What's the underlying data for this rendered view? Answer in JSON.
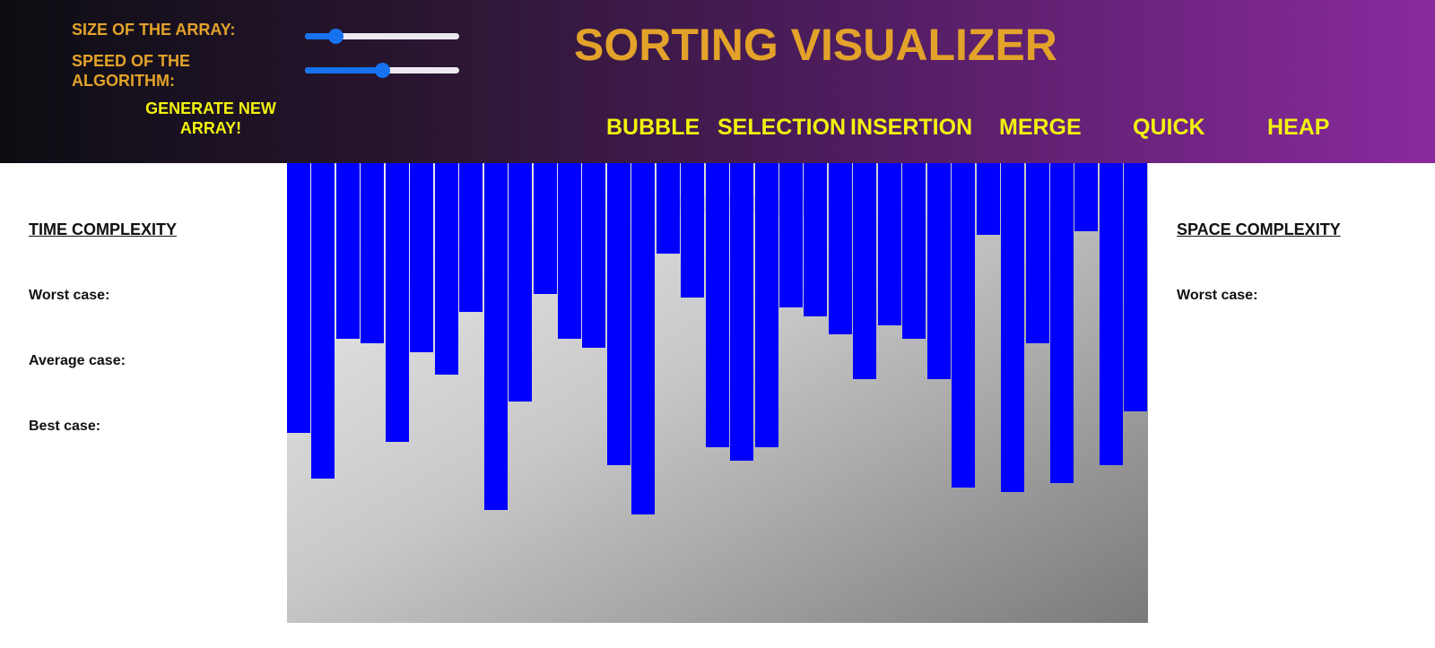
{
  "controls": {
    "size_label": "SIZE OF THE ARRAY:",
    "speed_label_1": "SPEED OF THE",
    "speed_label_2": "ALGORITHM:",
    "size_value": 0.2,
    "speed_value": 0.5,
    "generate_label_1": "GENERATE NEW",
    "generate_label_2": "ARRAY!"
  },
  "title": "SORTING VISUALIZER",
  "algorithms": [
    "BUBBLE",
    "SELECTION",
    "INSERTION",
    "MERGE",
    "QUICK",
    "HEAP"
  ],
  "time_complexity": {
    "heading": "TIME COMPLEXITY",
    "worst": "Worst case:",
    "average": "Average case:",
    "best": "Best case:"
  },
  "space_complexity": {
    "heading": "SPACE COMPLEXITY",
    "worst": "Worst case:"
  },
  "array": {
    "bar_color": "#0000ff",
    "values": [
      301,
      352,
      196,
      201,
      311,
      211,
      236,
      166,
      387,
      266,
      146,
      196,
      206,
      337,
      392,
      101,
      150,
      317,
      332,
      317,
      161,
      171,
      191,
      241,
      181,
      196,
      241,
      362,
      80,
      367,
      201,
      357,
      76,
      337,
      277
    ]
  },
  "colors": {
    "accent_orange": "#e3a22a",
    "accent_yellow": "#f2f20f",
    "slider_blue": "#1772f0"
  }
}
